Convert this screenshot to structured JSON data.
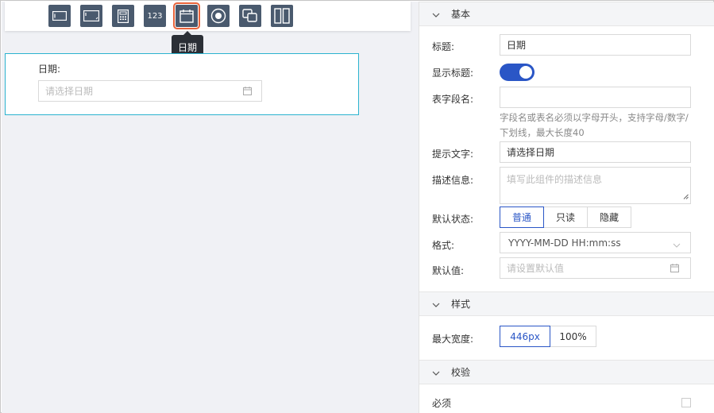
{
  "toolbar": {
    "tools": [
      {
        "name": "single-line-input-icon"
      },
      {
        "name": "multi-line-input-icon"
      },
      {
        "name": "calculator-icon"
      },
      {
        "name": "number-field-icon",
        "text": "123"
      },
      {
        "name": "date-field-icon",
        "active": true
      },
      {
        "name": "radio-icon"
      },
      {
        "name": "checkbox-group-icon"
      },
      {
        "name": "two-column-layout-icon"
      }
    ],
    "tooltip": "日期"
  },
  "canvas": {
    "field_label": "日期:",
    "field_placeholder": "请选择日期"
  },
  "panel": {
    "sections": {
      "basic": "基本",
      "style": "样式",
      "validation": "校验"
    },
    "title_label": "标题:",
    "title_value": "日期",
    "show_title_label": "显示标题:",
    "show_title_on": true,
    "field_name_label": "表字段名:",
    "field_name_value": "",
    "field_name_hint": "字段名或表名必须以字母开头，支持字母/数字/下划线，最大长度40",
    "placeholder_label": "提示文字:",
    "placeholder_value": "请选择日期",
    "desc_label": "描述信息:",
    "desc_placeholder": "填写此组件的描述信息",
    "default_state_label": "默认状态:",
    "default_state_options": [
      "普通",
      "只读",
      "隐藏"
    ],
    "default_state_selected": "普通",
    "format_label": "格式:",
    "format_value": "YYYY-MM-DD HH:mm:ss",
    "default_value_label": "默认值:",
    "default_value_placeholder": "请设置默认值",
    "max_width_label": "最大宽度:",
    "max_width_options": [
      "446px",
      "100%"
    ],
    "max_width_selected": "446px",
    "required_label": "必须"
  },
  "colors": {
    "accent": "#2a56c6",
    "tool_bg": "#4a5a6e",
    "active_outline": "#e8643c",
    "selected_border": "#2bb3cf"
  }
}
